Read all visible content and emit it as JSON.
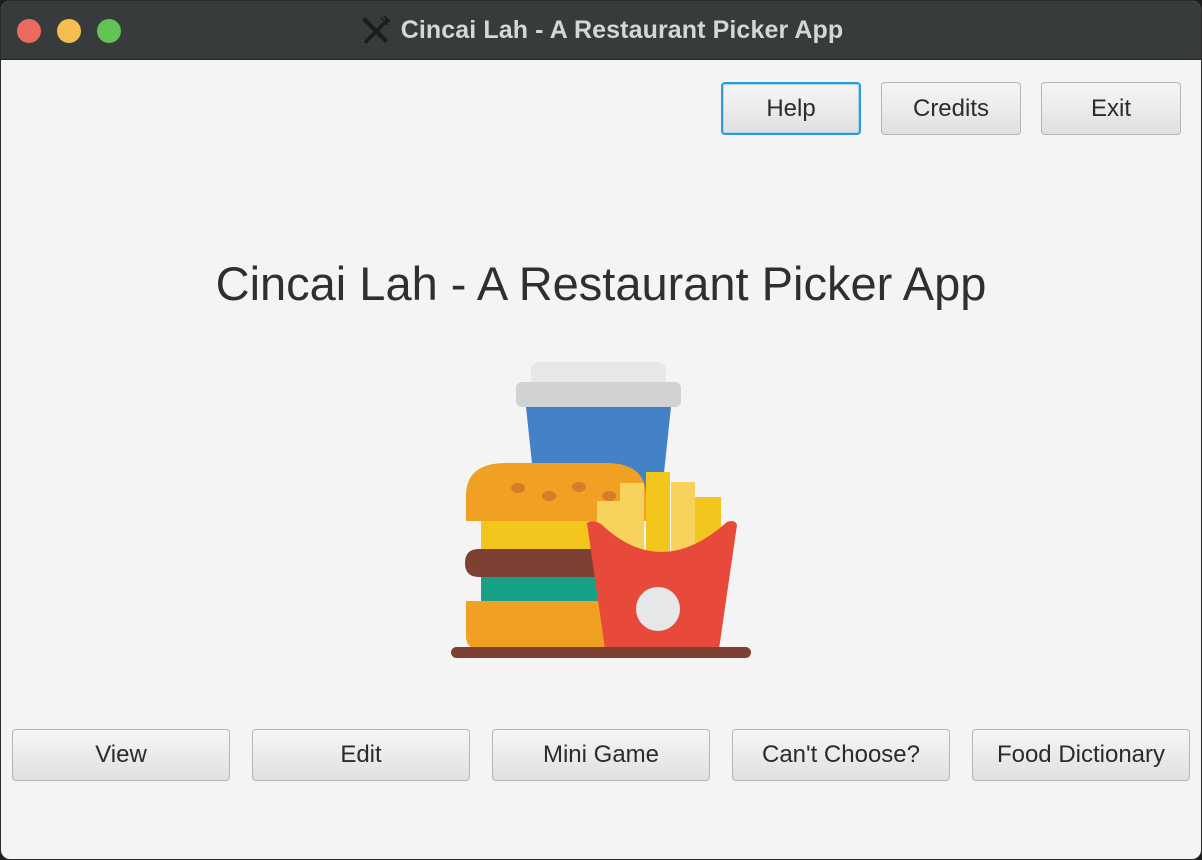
{
  "window": {
    "title": "Cincai Lah - A Restaurant Picker App",
    "title_icon": "fork-knife-icon"
  },
  "top_buttons": {
    "help": "Help",
    "credits": "Credits",
    "exit": "Exit"
  },
  "main": {
    "heading": "Cincai Lah - A Restaurant Picker App",
    "illustration": "fast-food-illustration"
  },
  "bottom_buttons": {
    "view": "View",
    "edit": "Edit",
    "mini_game": "Mini Game",
    "cant_choose": "Can't Choose?",
    "food_dictionary": "Food Dictionary"
  },
  "colors": {
    "titlebar": "#383b3b",
    "background": "#f4f4f4",
    "focus_ring": "#2f9bd6"
  }
}
